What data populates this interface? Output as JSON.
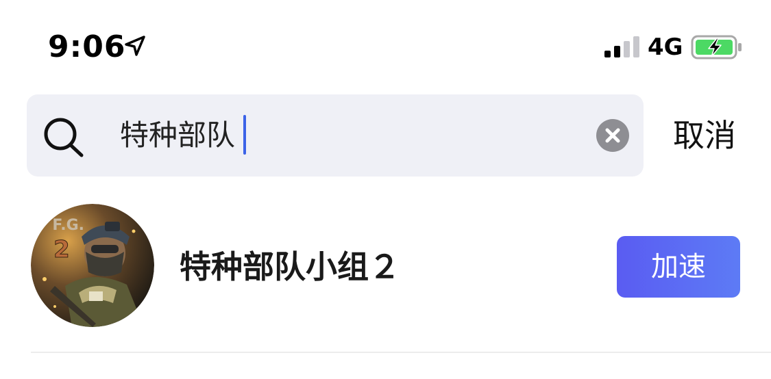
{
  "status_bar": {
    "time": "9:06",
    "network": "4G",
    "location_icon": "location-arrow-icon",
    "signal_icon": "cellular-signal-icon",
    "battery_icon": "battery-charging-icon",
    "battery_color": "#4cd964"
  },
  "search": {
    "query": "特种部队",
    "search_icon": "search-icon",
    "clear_icon": "clear-icon",
    "cancel_label": "取消",
    "caret_color": "#3c63e8"
  },
  "results": [
    {
      "title": "特种部队小组２",
      "action_label": "加速",
      "avatar_icon": "game-avatar-image"
    }
  ],
  "colors": {
    "accent": "#5a5cf2",
    "search_bg": "#eff0f6"
  }
}
